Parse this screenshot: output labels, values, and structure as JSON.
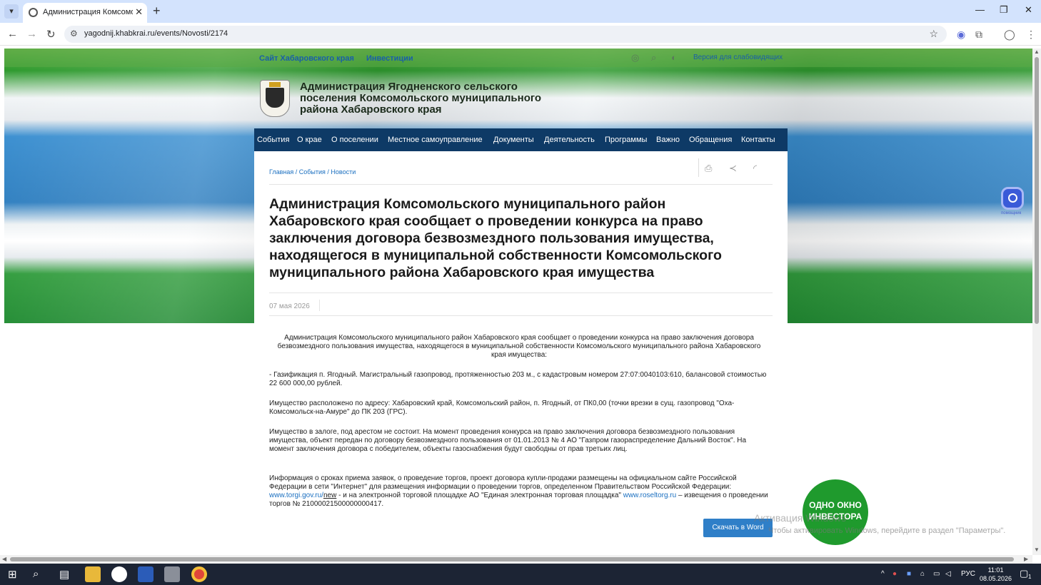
{
  "browser": {
    "tab_title": "Администрация Комсомольск",
    "url": "yagodnij.khabkrai.ru/events/Novosti/2174"
  },
  "topbar": {
    "link_site": "Сайт Хабаровского края",
    "link_invest": "Инвестиции",
    "vision": "Версия для слабовидящих"
  },
  "site": {
    "title": "Администрация Ягодненского сельского поселения Комсомольского муниципального района Хабаровского края"
  },
  "nav": [
    "События",
    "О крае",
    "О поселении",
    "Местное самоуправление",
    "Документы",
    "Деятельность",
    "Программы",
    "Важно",
    "Обращения",
    "Контакты"
  ],
  "breadcrumb": "Главная / События / Новости",
  "article": {
    "title": "Администрация Комсомольского муниципального район Хабаровского края сообщает о проведении конкурса на право заключения договора безвозмездного пользования имущества, находящегося в муниципальной собственности Комсомольского муниципального района Хабаровского края имущества",
    "date": "07 мая 2026",
    "intro": "Администрация Комсомольского муниципального район Хабаровского края сообщает о проведении конкурса на право заключения договора безвозмездного пользования имущества, находящегося в муниципальной собственности Комсомольского муниципального района Хабаровского края имущества:",
    "p1": "- Газификация п. Ягодный. Магистральный газопровод, протяженностью 203 м., с кадастровым номером 27:07:0040103:610, балансовой стоимостью 22 600 000,00 рублей.",
    "p2": "Имущество расположено по адресу: Хабаровский край, Комсомольский район, п. Ягодный, от ПК0,00 (точки врезки в сущ. газопровод \"Оха-Комсомольск-на-Амуре\" до ПК 203 (ГРС).",
    "p3": "Имущество в залоге, под арестом не состоит. На момент проведения конкурса на право заключения договора безвозмездного пользования имущества, объект передан по договору безвозмездного пользования от 01.01.2013 № 4 АО \"Газпром газораспределение Дальний Восток\". На момент заключения договора с победителем, объекты газоснабжения будут свободны от прав третьих лиц.",
    "p4_a": "Информация о сроках приема заявок, о проведение торгов, проект договора купли-продажи размещены на официальном сайте Российской Федерации в сети \"Интернет\" для размещения информации о проведении торгов, определенном Правительством Российской Федерации: ",
    "p4_link1": "www.torgi.gov.ru/",
    "p4_link1b": "new",
    "p4_b": " - и на электронной торговой площадке АО \"Единая электронная торговая площадка\" ",
    "p4_link2": "www.roseltorg.ru",
    "p4_c": " – извещения о проведении торгов № 21000021500000000417.",
    "download": "Скачать в Word"
  },
  "widgets": {
    "side_label": "помощник",
    "investor": "ОДНО ОКНО ИНВЕСТОРА"
  },
  "watermark": {
    "line1": "Активация Windows",
    "line2": "Чтобы активировать Windows, перейдите в раздел \"Параметры\"."
  },
  "taskbar": {
    "lang": "РУС",
    "time": "11:01",
    "date": "08.05.2026",
    "notif_count": "1"
  }
}
